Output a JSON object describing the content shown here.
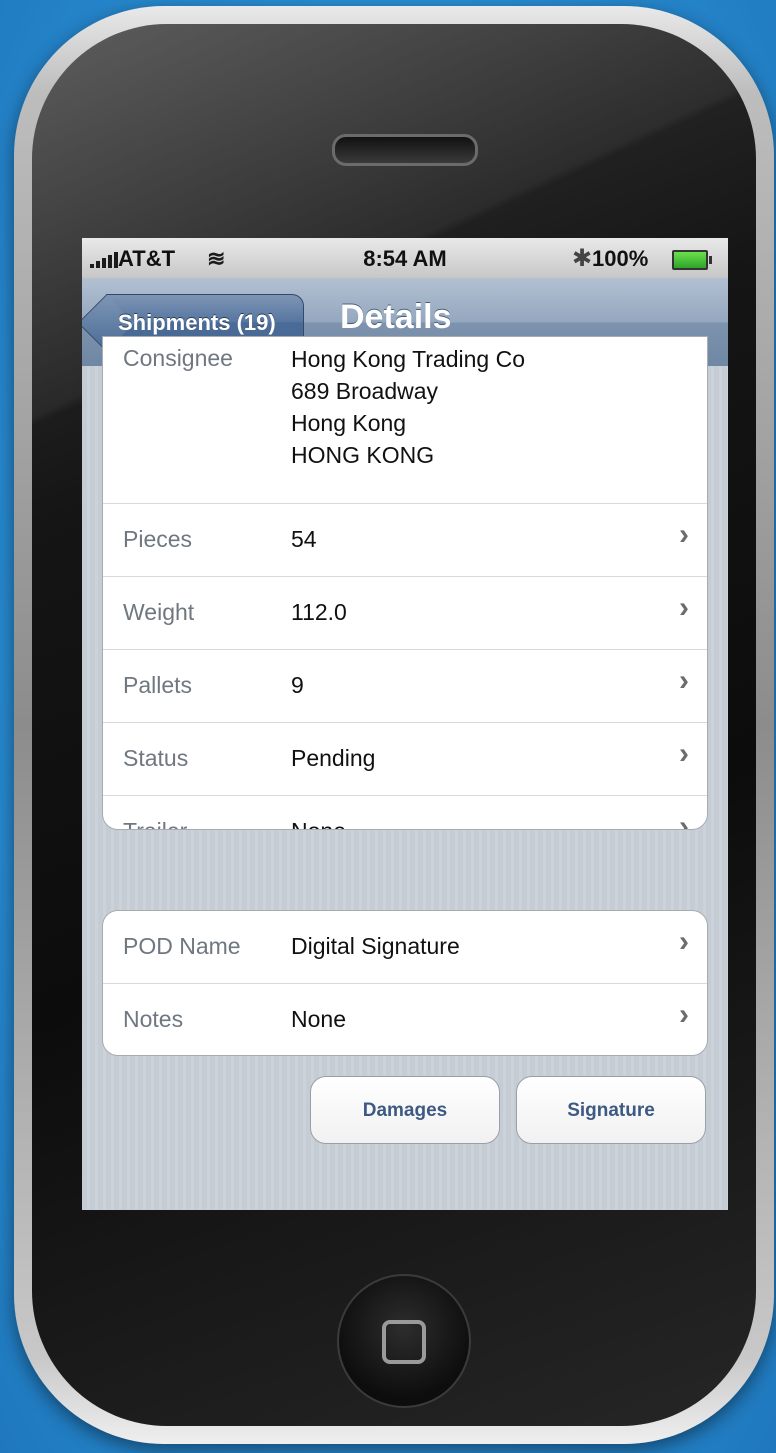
{
  "status_bar": {
    "carrier": "AT&T",
    "time": "8:54 AM",
    "battery": "100%",
    "icons": [
      "signal-icon",
      "wifi-icon",
      "bluetooth-icon",
      "battery-charging-icon"
    ]
  },
  "navbar": {
    "back_label": "Shipments (19)",
    "title": "Details"
  },
  "details": {
    "consignee": {
      "label": "Consignee",
      "lines": [
        "Hong Kong Trading Co",
        "689 Broadway",
        "Hong Kong",
        "HONG KONG"
      ]
    },
    "rows": [
      {
        "label": "Pieces",
        "value": "54"
      },
      {
        "label": "Weight",
        "value": "112.0"
      },
      {
        "label": "Pallets",
        "value": "9"
      },
      {
        "label": "Status",
        "value": "Pending"
      },
      {
        "label": "Trailer",
        "value": "None"
      }
    ]
  },
  "extra": {
    "rows": [
      {
        "label": "POD Name",
        "value": "Digital Signature"
      },
      {
        "label": "Notes",
        "value": "None"
      }
    ]
  },
  "buttons": {
    "damages": "Damages",
    "signature": "Signature"
  },
  "colors": {
    "navbar": "#7d93ae",
    "background": "#c5ccd4",
    "button_text": "#3e5a83"
  }
}
